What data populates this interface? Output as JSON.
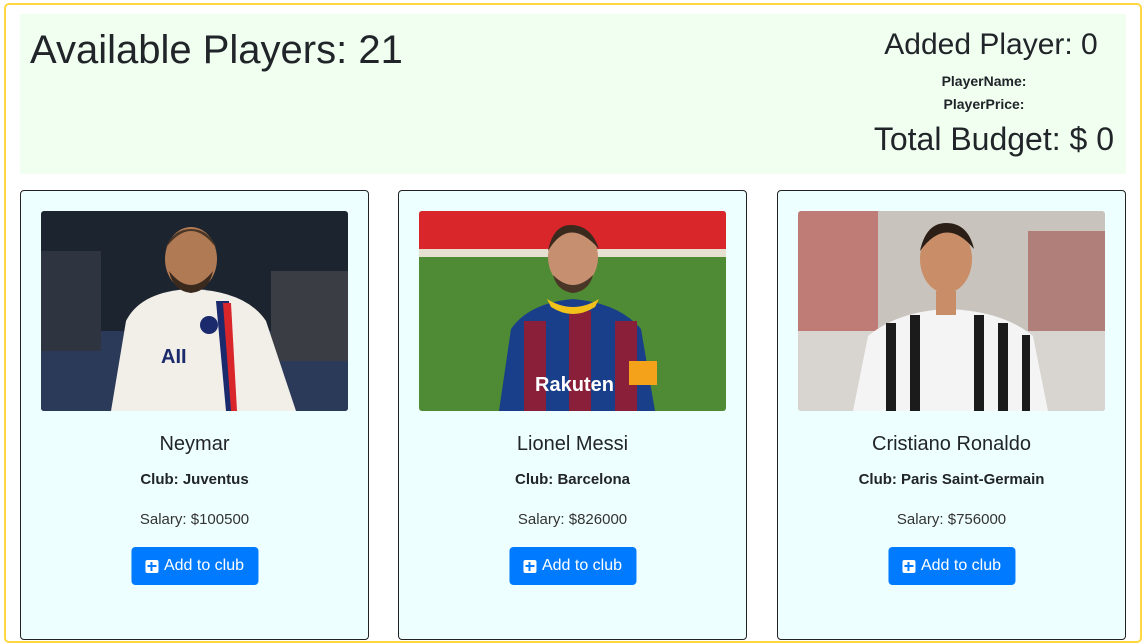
{
  "header": {
    "available_label": "Available Players: 21",
    "added_label": "Added Player: 0",
    "player_name_label": "PlayerName:",
    "player_price_label": "PlayerPrice:",
    "budget_label": "Total Budget: $ 0"
  },
  "players": [
    {
      "name": "Neymar",
      "club": "Club: Juventus",
      "salary": "Salary: $100500",
      "button": "Add to club",
      "photo": "player-photo"
    },
    {
      "name": "Lionel Messi",
      "club": "Club: Barcelona",
      "salary": "Salary: $826000",
      "button": "Add to club",
      "photo": "player-photo"
    },
    {
      "name": "Cristiano Ronaldo",
      "club": "Club: Paris Saint-Germain",
      "salary": "Salary: $756000",
      "button": "Add to club",
      "photo": "player-photo"
    }
  ],
  "colors": {
    "header_bg": "#f0fff0",
    "card_bg": "#eeffff",
    "button": "#007bff",
    "frame_border": "#ffd740"
  },
  "icons": {
    "button_icon": "plus-square-icon"
  }
}
